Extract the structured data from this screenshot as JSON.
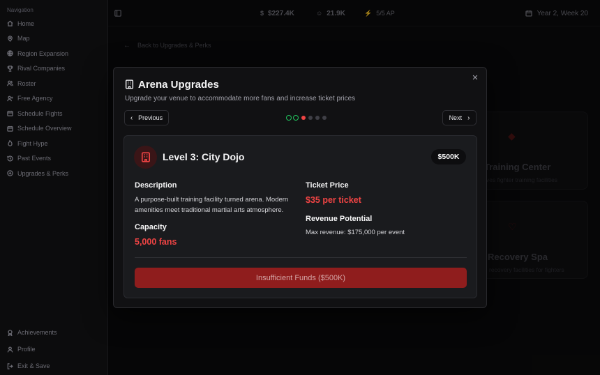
{
  "sidebar": {
    "heading": "Navigation",
    "items": [
      {
        "label": "Home",
        "icon": "home-icon"
      },
      {
        "label": "Map",
        "icon": "map-pin-icon"
      },
      {
        "label": "Region Expansion",
        "icon": "globe-icon"
      },
      {
        "label": "Rival Companies",
        "icon": "trophy-icon"
      },
      {
        "label": "Roster",
        "icon": "users-icon"
      },
      {
        "label": "Free Agency",
        "icon": "user-plus-icon"
      },
      {
        "label": "Schedule Fights",
        "icon": "calendar-icon"
      },
      {
        "label": "Schedule Overview",
        "icon": "calendar-icon"
      },
      {
        "label": "Fight Hype",
        "icon": "flame-icon"
      },
      {
        "label": "Past Events",
        "icon": "history-icon"
      },
      {
        "label": "Upgrades & Perks",
        "icon": "plus-circle-icon"
      }
    ],
    "bottom_items": [
      {
        "label": "Achievements",
        "icon": "award-icon"
      },
      {
        "label": "Profile",
        "icon": "user-icon"
      },
      {
        "label": "Exit & Save",
        "icon": "log-out-icon"
      }
    ]
  },
  "topbar": {
    "money": "$227.4K",
    "fans": "21.9K",
    "ap": "5/5 AP",
    "date": "Year 2, Week 20"
  },
  "background": {
    "back_link": "Back to Upgrades & Perks",
    "cards": [
      {
        "title": "Training Center",
        "subtitle": "ves fighter training facilities"
      },
      {
        "title": "Recovery Spa",
        "subtitle": "recovery facilities for fighters"
      }
    ]
  },
  "modal": {
    "title": "Arena Upgrades",
    "subtitle": "Upgrade your venue to accommodate more fans and increase ticket prices",
    "prev_label": "Previous",
    "next_label": "Next",
    "steps": {
      "completed": 2,
      "current": 3,
      "total": 6
    },
    "level": {
      "title": "Level 3: City Dojo",
      "price": "$500K",
      "description_heading": "Description",
      "description": "A purpose-built training facility turned arena. Modern amenities meet traditional martial arts atmosphere.",
      "capacity_heading": "Capacity",
      "capacity": "5,000 fans",
      "ticket_heading": "Ticket Price",
      "ticket_price": "$35 per ticket",
      "revenue_heading": "Revenue Potential",
      "revenue": "Max revenue: $175,000 per event",
      "action_label": "Insufficient Funds ($500K)"
    }
  },
  "colors": {
    "accent": "#ef4444",
    "success": "#22c55e",
    "button_disabled": "#8f1d1d",
    "ap": "#eab308"
  }
}
